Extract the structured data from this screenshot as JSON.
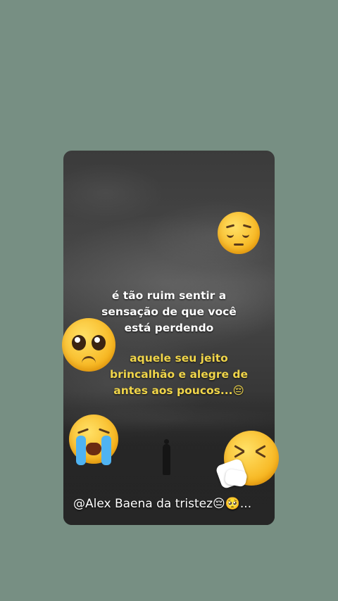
{
  "post": {
    "caption_white": [
      "é tão ruim sentir a",
      "sensação de que você",
      "está perdendo"
    ],
    "caption_yellow": [
      "aquele seu jeito",
      "brincalhão e alegre de",
      "antes aos poucos...😔"
    ],
    "footer_text": "@Alex Baena da tristez😔🥺...",
    "emojis": [
      "pensive-face-icon",
      "pleading-face-icon",
      "loudly-crying-face-icon",
      "sneezing-face-icon"
    ]
  },
  "colors": {
    "background": "#778f83",
    "caption_white": "#ffffff",
    "caption_yellow": "#f0d54a"
  }
}
